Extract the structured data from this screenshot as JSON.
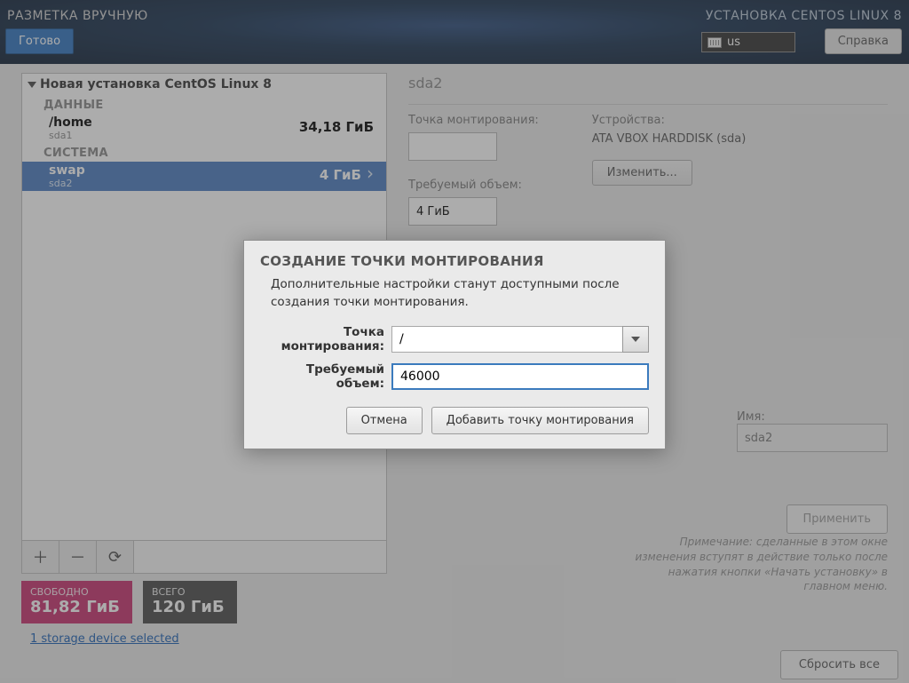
{
  "header": {
    "title_left": "РАЗМЕТКА ВРУЧНУЮ",
    "title_right": "УСТАНОВКА CENTOS LINUX 8",
    "done": "Готово",
    "help": "Справка",
    "kb_layout": "us"
  },
  "tree": {
    "root": "Новая установка CentOS Linux 8",
    "section_data": "ДАННЫЕ",
    "section_system": "СИСТЕМА",
    "items": [
      {
        "name": "/home",
        "dev": "sda1",
        "size": "34,18 ГиБ",
        "section": "data",
        "selected": false
      },
      {
        "name": "swap",
        "dev": "sda2",
        "size": "4 ГиБ",
        "section": "system",
        "selected": true
      }
    ]
  },
  "summary": {
    "free_label": "СВОБОДНО",
    "free_value": "81,82 ГиБ",
    "total_label": "ВСЕГО",
    "total_value": "120 ГиБ",
    "storage_link": "1 storage device selected"
  },
  "detail": {
    "title": "sda2",
    "mount_label": "Точка монтирования:",
    "mount_value": "",
    "capacity_label": "Требуемый объем:",
    "capacity_value": "4 ГиБ",
    "devices_label": "Устройства:",
    "devices_value": "ATA VBOX HARDDISK (sda)",
    "modify": "Изменить...",
    "name_label": "Имя:",
    "name_value": "sda2",
    "apply": "Применить",
    "note": "Примечание:  сделанные в этом окне изменения вступят в действие только после нажатия кнопки «Начать установку» в главном меню."
  },
  "bottom": {
    "reset": "Сбросить все"
  },
  "dialog": {
    "title": "СОЗДАНИЕ ТОЧКИ МОНТИРОВАНИЯ",
    "message": "Дополнительные настройки станут доступными после создания точки монтирования.",
    "mount_label": "Точка монтирования:",
    "mount_value": "/",
    "capacity_label": "Требуемый объем:",
    "capacity_value": "46000",
    "cancel": "Отмена",
    "add": "Добавить точку монтирования"
  }
}
